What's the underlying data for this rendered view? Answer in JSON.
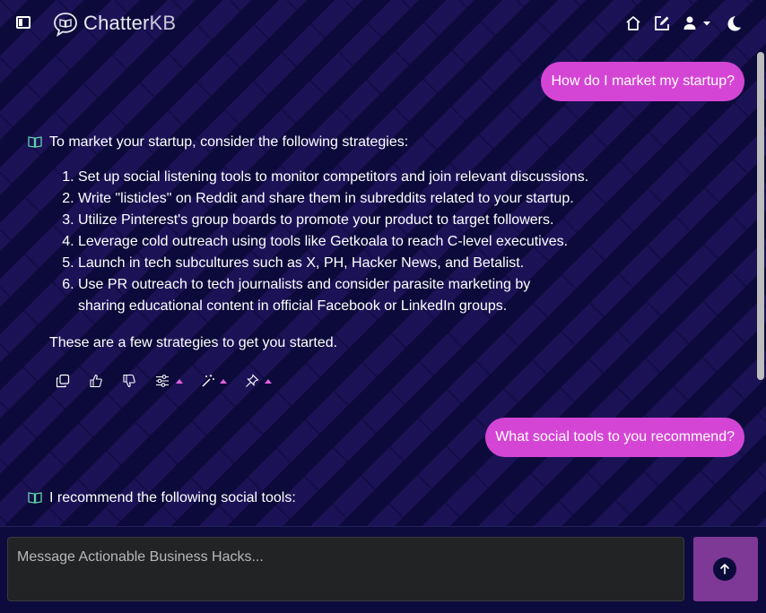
{
  "app": {
    "title_main": "Chatter",
    "title_suffix": "KB"
  },
  "header_icons": [
    "sidebar-toggle-icon",
    "home-icon",
    "edit-icon",
    "user-icon",
    "chevron-down-icon",
    "moon-icon"
  ],
  "messages": [
    {
      "role": "user",
      "text": "How do I market my startup?"
    },
    {
      "role": "assistant",
      "intro": "To market your startup, consider the following strategies:",
      "items": [
        "Set up social listening tools to monitor competitors and join relevant discussions.",
        "Write \"listicles\" on Reddit and share them in subreddits related to your startup.",
        "Utilize Pinterest's group boards to promote your product to target followers.",
        "Leverage cold outreach using tools like Getkoala to reach C-level executives.",
        "Launch in tech subcultures such as X, PH, Hacker News, and Betalist.",
        "Use PR outreach to tech journalists and consider parasite marketing by sharing educational content in official Facebook or LinkedIn groups."
      ],
      "outro": "These are a few strategies to get you started.",
      "action_icons": [
        "copy-icon",
        "thumbs-up-icon",
        "thumbs-down-icon",
        "sliders-icon",
        "magic-wand-icon",
        "pin-icon"
      ]
    },
    {
      "role": "user",
      "text": "What social tools to you recommend?"
    },
    {
      "role": "assistant",
      "intro": "I recommend the following social tools:"
    }
  ],
  "composer": {
    "placeholder": "Message Actionable Business Hacks...",
    "value": ""
  },
  "colors": {
    "background": "#0c0a3a",
    "user_bubble": "#d545d5",
    "send_button": "#7e3896",
    "accent_icon": "#5fd3a8"
  }
}
